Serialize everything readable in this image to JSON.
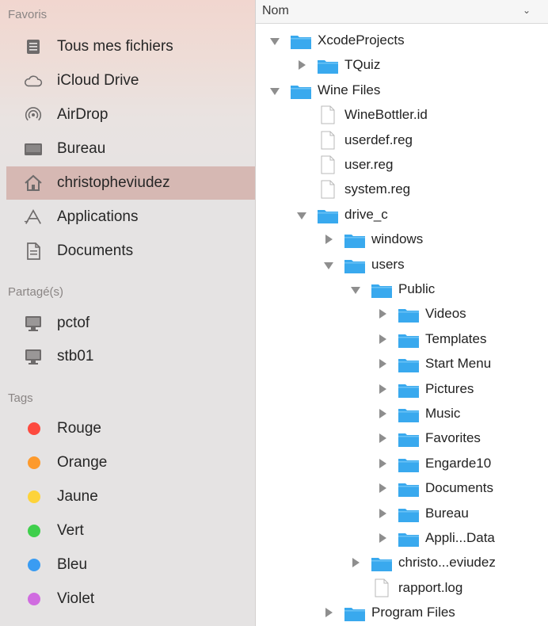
{
  "sidebar": {
    "sections": {
      "favorites": "Favoris",
      "shared": "Partagé(s)",
      "tags": "Tags"
    },
    "favorites": [
      {
        "label": "Tous mes fichiers",
        "icon": "all-files-icon"
      },
      {
        "label": "iCloud Drive",
        "icon": "cloud-icon"
      },
      {
        "label": "AirDrop",
        "icon": "airdrop-icon"
      },
      {
        "label": "Bureau",
        "icon": "desktop-icon"
      },
      {
        "label": "christopheviudez",
        "icon": "home-icon",
        "selected": true
      },
      {
        "label": "Applications",
        "icon": "applications-icon"
      },
      {
        "label": "Documents",
        "icon": "documents-icon"
      }
    ],
    "shared": [
      {
        "label": "pctof",
        "icon": "computer-icon"
      },
      {
        "label": "stb01",
        "icon": "computer-icon"
      }
    ],
    "tags": [
      {
        "label": "Rouge",
        "color": "#fd4a3f"
      },
      {
        "label": "Orange",
        "color": "#fd9a2c"
      },
      {
        "label": "Jaune",
        "color": "#fdd33a"
      },
      {
        "label": "Vert",
        "color": "#3fcf4c"
      },
      {
        "label": "Bleu",
        "color": "#3a9cf2"
      },
      {
        "label": "Violet",
        "color": "#d06ce0"
      }
    ],
    "selected_color": "#d6b8b3"
  },
  "file_list": {
    "column_header": "Nom",
    "folder_color": "#39a9ee",
    "rows": [
      {
        "name": "XcodeProjects",
        "type": "folder",
        "depth": 0,
        "expanded": true
      },
      {
        "name": "TQuiz",
        "type": "folder",
        "depth": 1,
        "expanded": false
      },
      {
        "name": "Wine Files",
        "type": "folder",
        "depth": 0,
        "expanded": true
      },
      {
        "name": "WineBottler.id",
        "type": "file",
        "depth": 1
      },
      {
        "name": "userdef.reg",
        "type": "file",
        "depth": 1
      },
      {
        "name": "user.reg",
        "type": "file",
        "depth": 1
      },
      {
        "name": "system.reg",
        "type": "file",
        "depth": 1
      },
      {
        "name": "drive_c",
        "type": "folder",
        "depth": 1,
        "expanded": true
      },
      {
        "name": "windows",
        "type": "folder",
        "depth": 2,
        "expanded": false
      },
      {
        "name": "users",
        "type": "folder",
        "depth": 2,
        "expanded": true
      },
      {
        "name": "Public",
        "type": "folder",
        "depth": 3,
        "expanded": true
      },
      {
        "name": "Videos",
        "type": "folder",
        "depth": 4,
        "expanded": false
      },
      {
        "name": "Templates",
        "type": "folder",
        "depth": 4,
        "expanded": false
      },
      {
        "name": "Start Menu",
        "type": "folder",
        "depth": 4,
        "expanded": false
      },
      {
        "name": "Pictures",
        "type": "folder",
        "depth": 4,
        "expanded": false
      },
      {
        "name": "Music",
        "type": "folder",
        "depth": 4,
        "expanded": false
      },
      {
        "name": "Favorites",
        "type": "folder",
        "depth": 4,
        "expanded": false
      },
      {
        "name": "Engarde10",
        "type": "folder",
        "depth": 4,
        "expanded": false
      },
      {
        "name": "Documents",
        "type": "folder",
        "depth": 4,
        "expanded": false
      },
      {
        "name": "Bureau",
        "type": "folder",
        "depth": 4,
        "expanded": false
      },
      {
        "name": "Appli...Data",
        "type": "folder",
        "depth": 4,
        "expanded": false
      },
      {
        "name": "christo...eviudez",
        "type": "folder",
        "depth": 3,
        "expanded": false
      },
      {
        "name": "rapport.log",
        "type": "file",
        "depth": 3
      },
      {
        "name": "Program Files",
        "type": "folder",
        "depth": 2,
        "expanded": false
      }
    ]
  }
}
